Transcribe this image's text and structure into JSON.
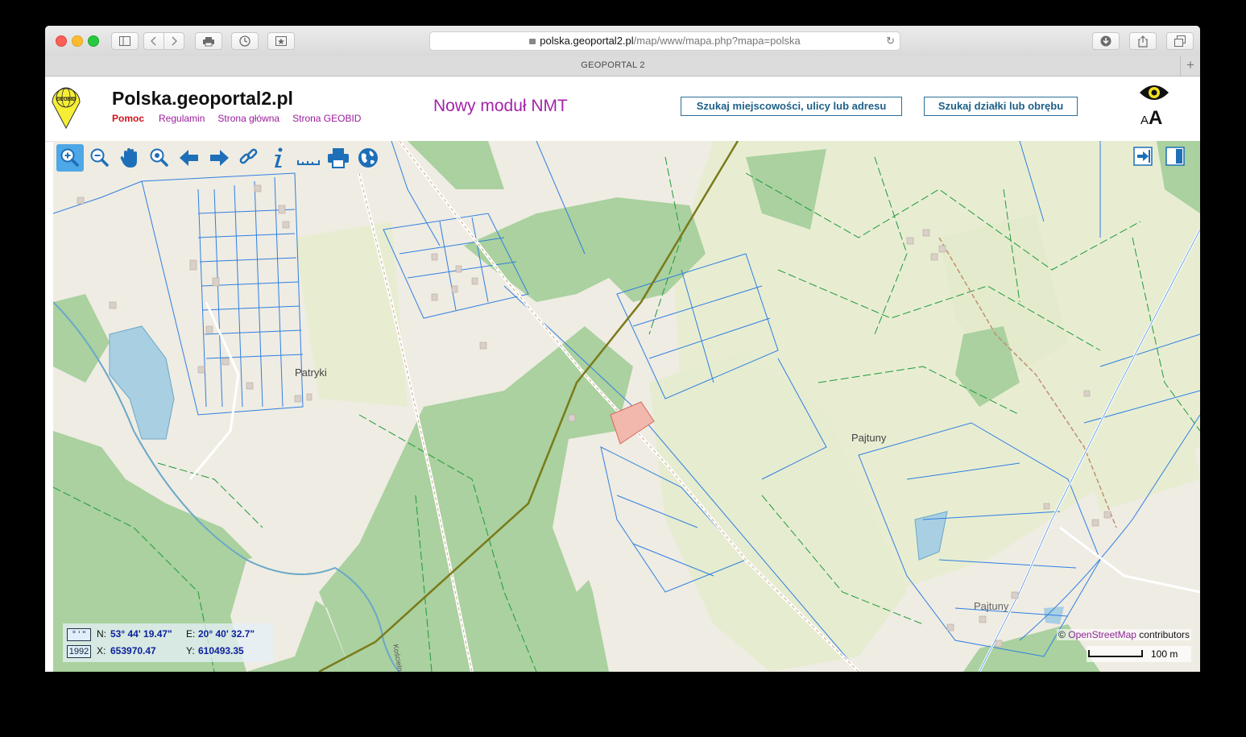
{
  "browser": {
    "address_host": "polska.geoportal2.pl",
    "address_path": "/map/www/mapa.php?mapa=polska",
    "tab_title": "GEOPORTAL 2",
    "new_tab_label": "+"
  },
  "header": {
    "logo_text": "GEOBID",
    "site_title": "Polska.geoportal2.pl",
    "links": {
      "help": "Pomoc",
      "rules": "Regulamin",
      "home": "Strona główna",
      "geobid": "Strona GEOBID"
    },
    "nmt_label": "Nowy moduł NMT",
    "search_address_label": "Szukaj miejscowości, ulicy lub adresu",
    "search_parcel_label": "Szukaj działki lub obrębu",
    "font_small": "A",
    "font_large": "A"
  },
  "map": {
    "tools": [
      "zoom-in-icon",
      "zoom-out-icon",
      "pan-hand-icon",
      "zoom-box-icon",
      "back-arrow-icon",
      "forward-arrow-icon",
      "link-icon",
      "info-icon",
      "measure-icon",
      "print-icon",
      "globe-icon"
    ],
    "places": {
      "patryki": "Patryki",
      "pajtuny": "Pajtuny",
      "pajtuny_small": "Pajtuny",
      "koscielna": "Kościelna"
    },
    "coordinates": {
      "dms_box": "° ' \"",
      "system_box": "1992",
      "n_label": "N:",
      "n_value": "53° 44' 19.47\"",
      "e_label": "E:",
      "e_value": "20° 40' 32.7\"",
      "x_label": "X:",
      "x_value": "653970.47",
      "y_label": "Y:",
      "y_value": "610493.35"
    },
    "attribution": {
      "prefix": "©",
      "osm": "OpenStreetMap",
      "suffix": "contributors"
    },
    "scale_label": "100 m",
    "colors": {
      "background": "#efece3",
      "forest": "#aad19f",
      "meadow": "#e8edd2",
      "water": "#a9cfe2",
      "parcel_blue": "#2f7fe0",
      "parcel_green": "#1f9a3a",
      "highlight": "#f2b7ad",
      "powerline": "#7a7a1a"
    }
  }
}
